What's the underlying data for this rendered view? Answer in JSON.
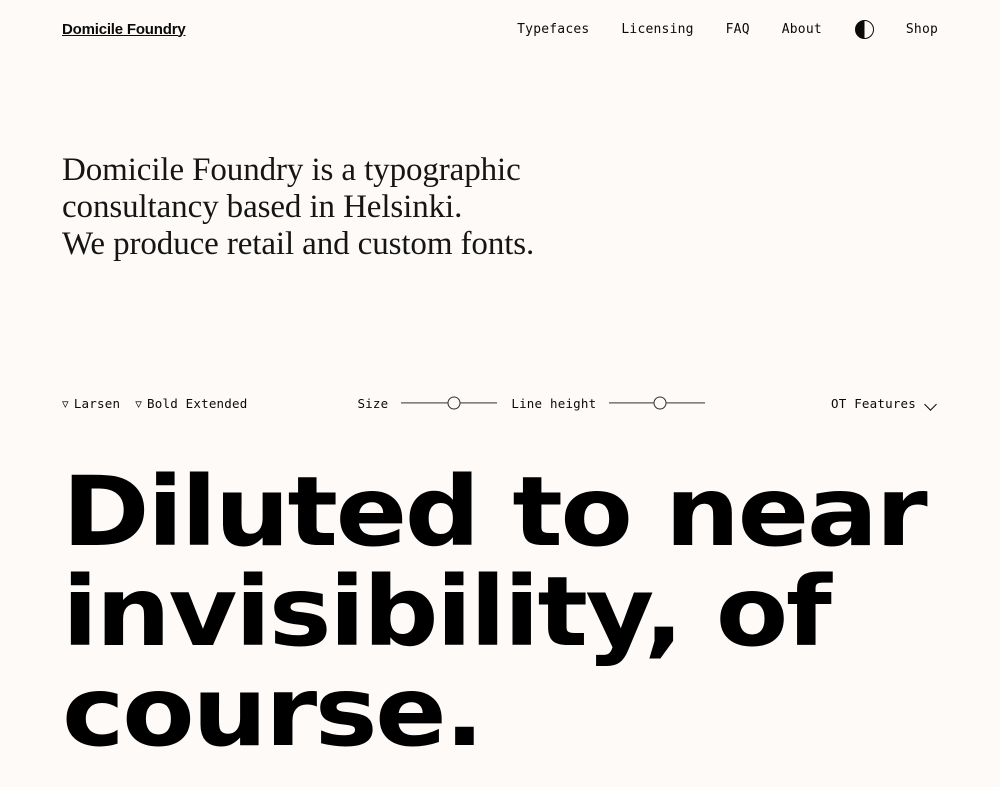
{
  "theme": {
    "background": "#fdfaf8",
    "foreground": "#0a0a0a",
    "accent": "#000000"
  },
  "header": {
    "brand": "Domicile Foundry",
    "nav": [
      {
        "label": "Typefaces",
        "name": "nav-typefaces"
      },
      {
        "label": "Licensing",
        "name": "nav-licensing"
      },
      {
        "label": "FAQ",
        "name": "nav-faq"
      },
      {
        "label": "About",
        "name": "nav-about"
      },
      {
        "label": "Shop",
        "name": "nav-shop"
      }
    ],
    "theme_toggle_icon": "half-circle-icon"
  },
  "intro": {
    "line1": "Domicile Foundry is a typographic",
    "line2": "consultancy based in Helsinki.",
    "line3": "We produce retail and custom fonts."
  },
  "controls": {
    "typeface_selector": {
      "icon": "triangle-down-icon",
      "glyph": "▽",
      "value": "Larsen"
    },
    "style_selector": {
      "icon": "triangle-down-icon",
      "glyph": "▽",
      "value": "Bold Extended"
    },
    "size_slider": {
      "label": "Size",
      "value_percent": 55
    },
    "line_height_slider": {
      "label": "Line height",
      "value_percent": 53
    },
    "ot_features": {
      "label": "OT Features",
      "icon": "chevron-down-icon"
    }
  },
  "specimen": {
    "line1": "Diluted to near",
    "line2": "invisibility, of",
    "line3": "course."
  }
}
